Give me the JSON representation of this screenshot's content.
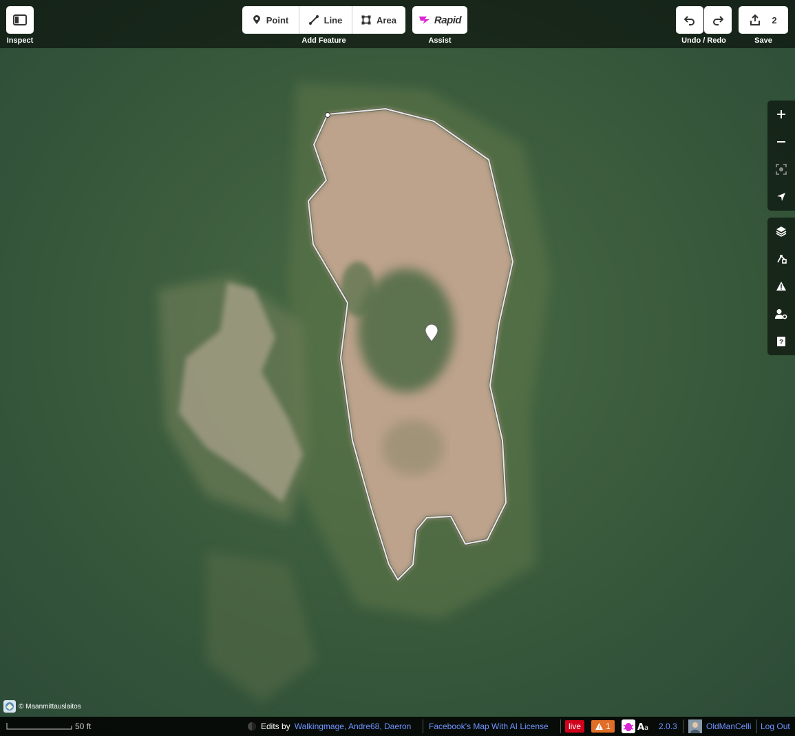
{
  "toolbar": {
    "inspect_caption": "Inspect",
    "add_feature_caption": "Add Feature",
    "point_label": "Point",
    "line_label": "Line",
    "area_label": "Area",
    "rapid_label": "Rapid",
    "assist_caption": "Assist",
    "undo_redo_caption": "Undo / Redo",
    "save_caption": "Save",
    "save_count": "2"
  },
  "map": {
    "attribution": "© Maanmittauslaitos"
  },
  "footer": {
    "scale_label": "50 ft",
    "edits_by_prefix": "Edits by",
    "editors": "Walkingmage, Andre68, Daeron",
    "license": "Facebook's Map With AI License",
    "live_badge": "live",
    "issues_count": "1",
    "version": "2.0.3",
    "user": "OldManCelli",
    "logout": "Log Out"
  },
  "colors": {
    "accent_link": "#7092ff",
    "live_red": "#d0021b",
    "warning_orange": "#e06e27",
    "rapid_magenta": "#da26d3"
  }
}
